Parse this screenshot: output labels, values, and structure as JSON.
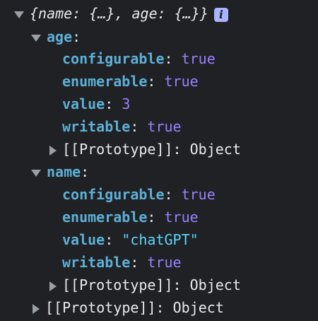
{
  "root": {
    "preview": "{name: {…}, age: {…}}",
    "info_icon": "i"
  },
  "age": {
    "key": "age",
    "props": [
      {
        "key": "configurable",
        "value": "true"
      },
      {
        "key": "enumerable",
        "value": "true"
      },
      {
        "key": "value",
        "value": "3"
      },
      {
        "key": "writable",
        "value": "true"
      }
    ],
    "proto_label": "[[Prototype]]",
    "proto_value": "Object"
  },
  "name": {
    "key": "name",
    "props": [
      {
        "key": "configurable",
        "value": "true"
      },
      {
        "key": "enumerable",
        "value": "true"
      },
      {
        "key": "value",
        "value": "\"chatGPT\""
      },
      {
        "key": "writable",
        "value": "true"
      }
    ],
    "proto_label": "[[Prototype]]",
    "proto_value": "Object"
  },
  "root_proto": {
    "label": "[[Prototype]]",
    "value": "Object"
  },
  "colors": {
    "background": "#202124",
    "key": "#5db0d7",
    "boolean": "#9980ff",
    "number": "#9980ff",
    "string": "#5cd5fb"
  }
}
